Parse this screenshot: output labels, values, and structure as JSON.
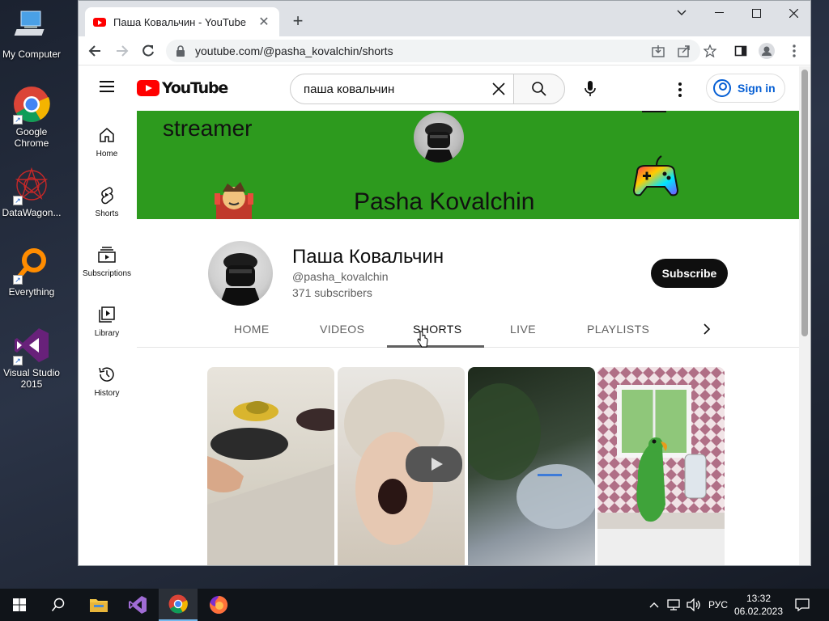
{
  "desktop": {
    "icons": [
      {
        "label": "My Computer"
      },
      {
        "label": "Google Chrome"
      },
      {
        "label": "DataWagon..."
      },
      {
        "label": "Everything"
      },
      {
        "label": "Visual Studio 2015"
      }
    ]
  },
  "browser": {
    "tab_title": "Паша Ковальчин - YouTube",
    "url": "youtube.com/@pasha_kovalchin/shorts"
  },
  "youtube": {
    "logo_text": "YouTube",
    "search_value": "паша ковальчин",
    "signin_label": "Sign in",
    "guide": [
      {
        "label": "Home"
      },
      {
        "label": "Shorts"
      },
      {
        "label": "Subscriptions"
      },
      {
        "label": "Library"
      },
      {
        "label": "History"
      }
    ],
    "banner": {
      "text_streamer": "streamer",
      "text_name": "Pasha Kovalchin"
    },
    "channel": {
      "name": "Паша Ковальчин",
      "handle": "@pasha_kovalchin",
      "subscribers": "371 subscribers",
      "subscribe_label": "Subscribe"
    },
    "tabs": [
      {
        "label": "HOME"
      },
      {
        "label": "VIDEOS"
      },
      {
        "label": "SHORTS"
      },
      {
        "label": "LIVE"
      },
      {
        "label": "PLAYLISTS"
      }
    ],
    "active_tab": "SHORTS"
  },
  "taskbar": {
    "language": "РУС",
    "time": "13:32",
    "date": "06.02.2023"
  },
  "colors": {
    "youtube_red": "#ff0000",
    "link_blue": "#065fd4",
    "banner_green": "#2d9a1e",
    "subscribe_bg": "#0f0f0f"
  }
}
